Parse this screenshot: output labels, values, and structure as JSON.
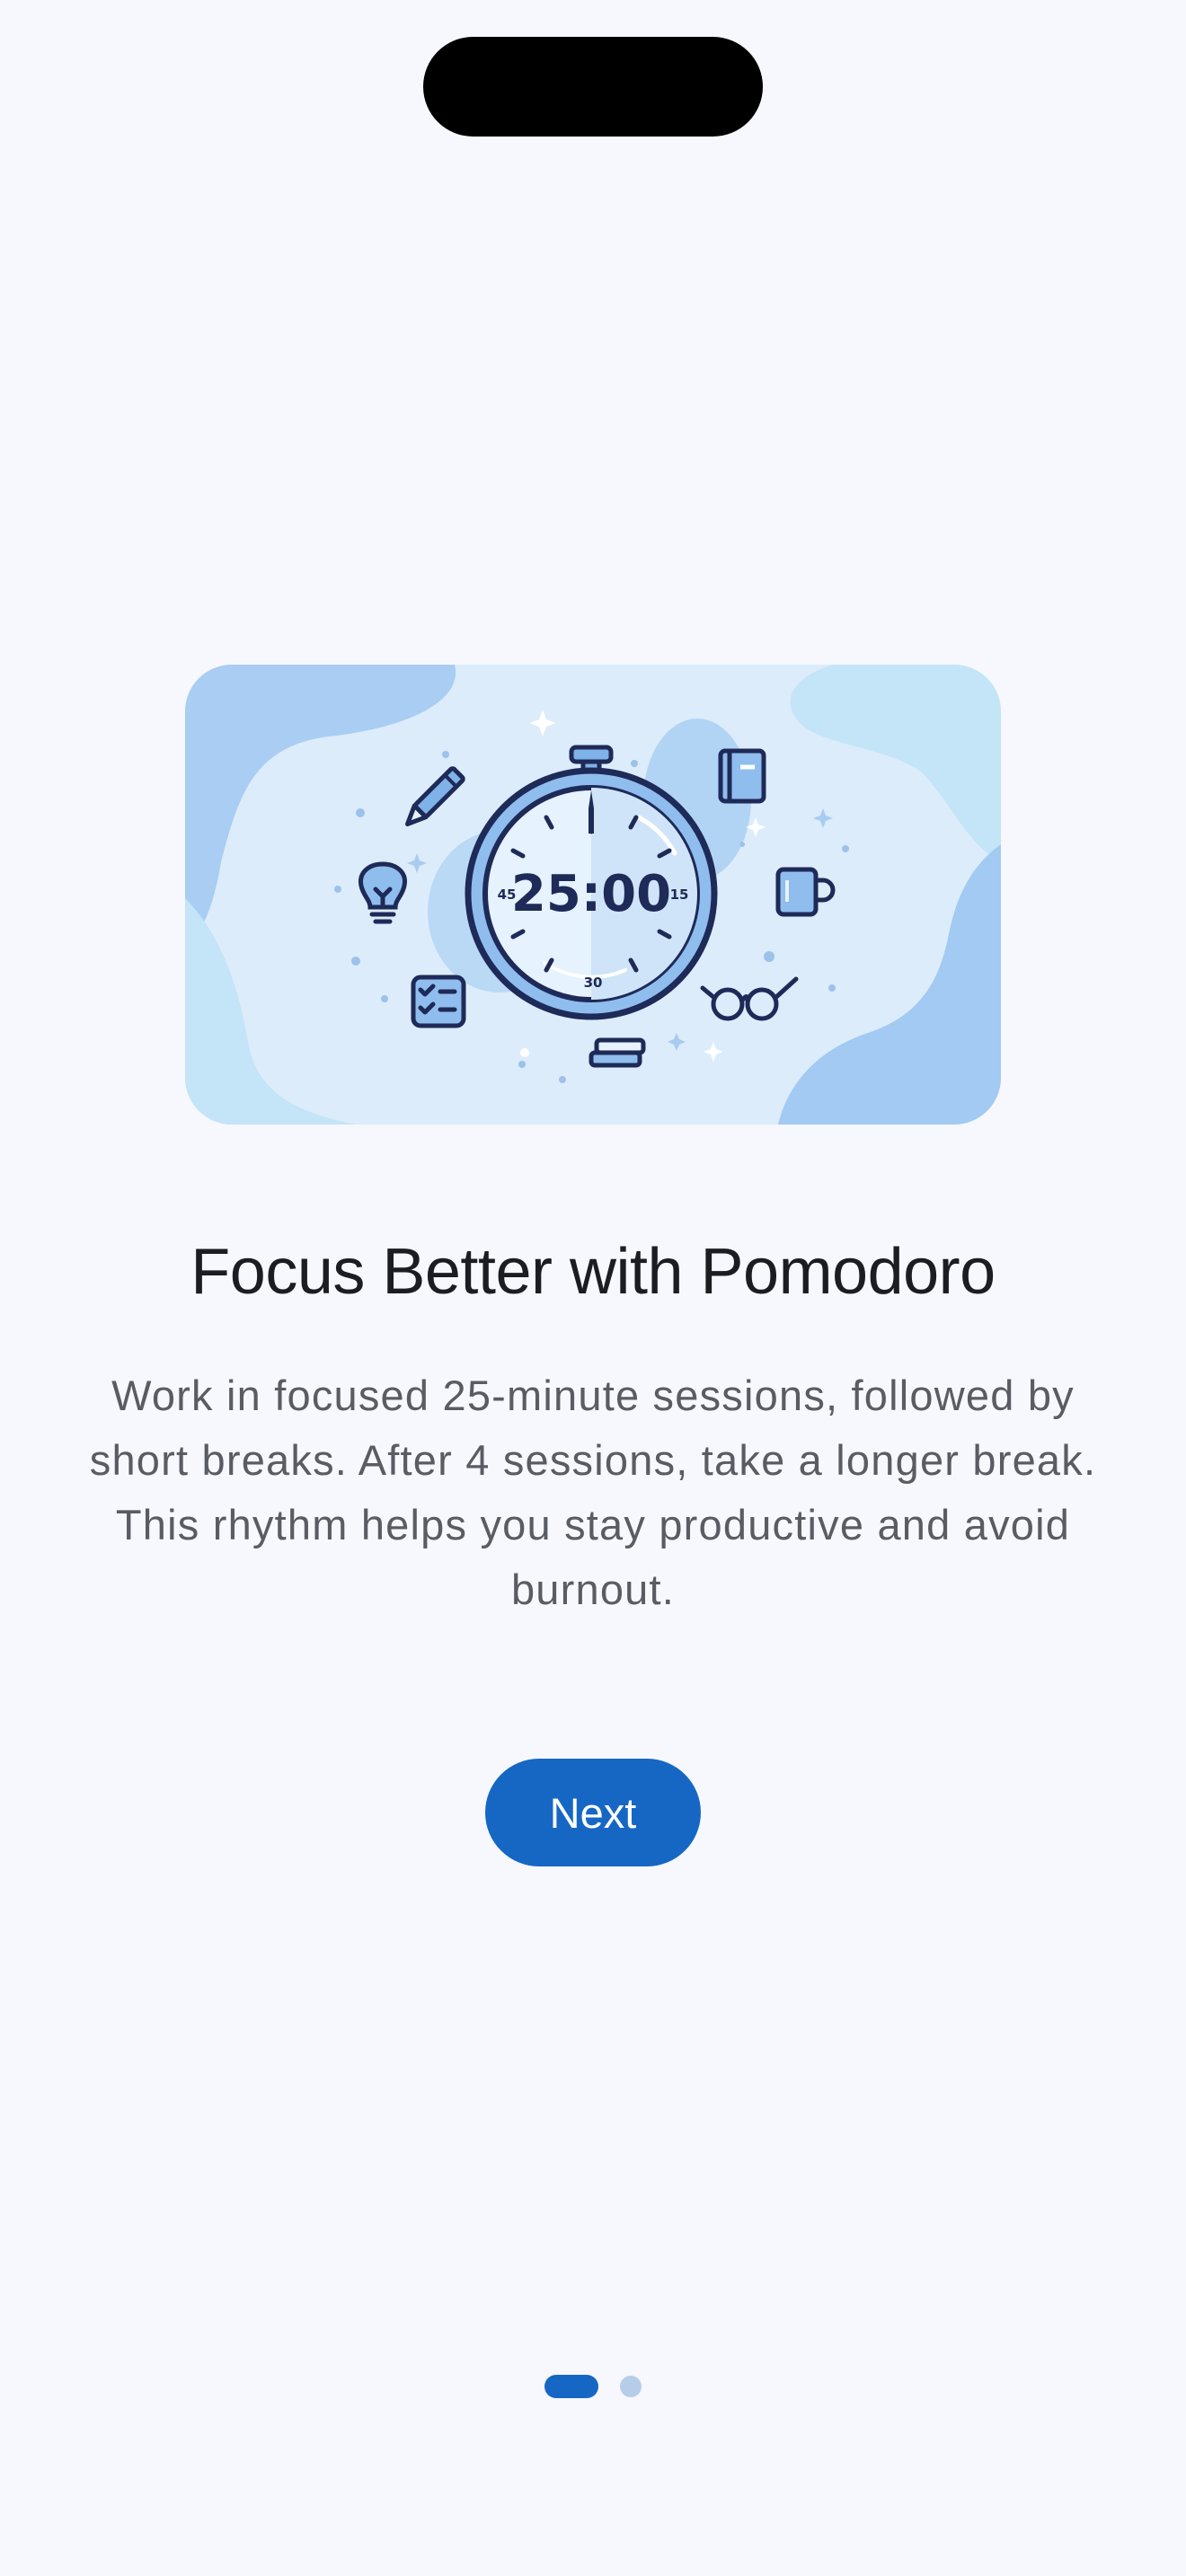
{
  "onboarding": {
    "title": "Focus Better with Pomodoro",
    "description": "Work in focused 25-minute sessions, followed by short breaks. After 4 sessions, take a longer break. This rhythm helps you stay productive and avoid burnout.",
    "next_label": "Next"
  },
  "illustration": {
    "timer_text": "25:00",
    "dial_labels": {
      "left": "45",
      "right": "15",
      "bottom": "30"
    },
    "icons": [
      "pencil-icon",
      "lightbulb-icon",
      "checklist-icon",
      "notebook-icon",
      "mug-icon",
      "glasses-icon",
      "books-icon",
      "stopwatch-icon"
    ]
  },
  "pagination": {
    "current": 1,
    "total": 2
  },
  "colors": {
    "accent": "#1667c4",
    "background": "#f6f8fd",
    "illustration_bg": "#dcecfb",
    "inactive_dot": "#b6cdea",
    "icon_stroke": "#1e2a57"
  }
}
